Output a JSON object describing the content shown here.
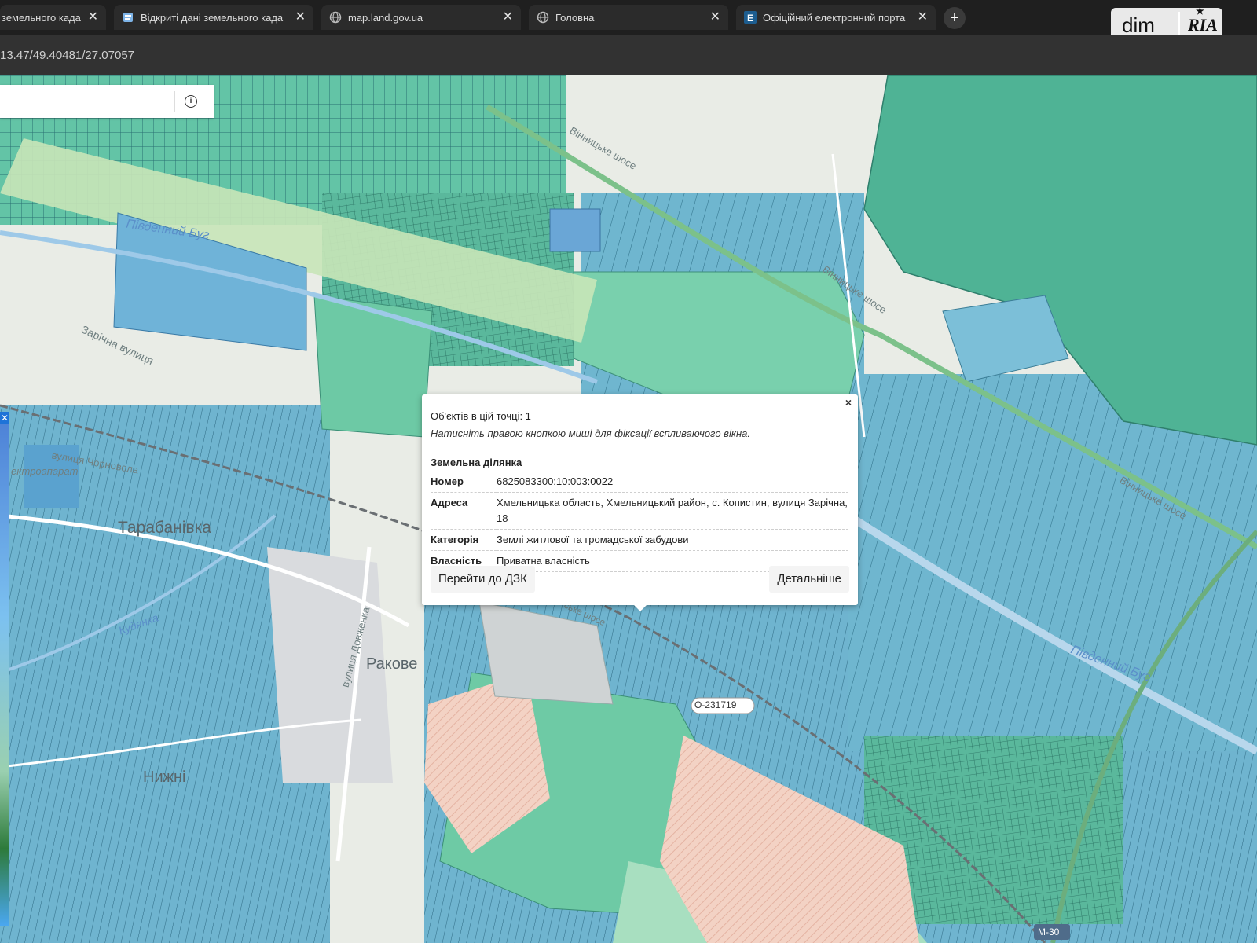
{
  "tabs": [
    {
      "label": "земельного када",
      "icon": "document-icon",
      "active": true
    },
    {
      "label": "Відкриті дані земельного када",
      "icon": "map-page-icon"
    },
    {
      "label": "map.land.gov.ua",
      "icon": "globe-icon"
    },
    {
      "label": "Головна",
      "icon": "globe-icon"
    },
    {
      "label": "Офіційний електронний порта",
      "icon": "e-logo-icon"
    }
  ],
  "new_tab": "+",
  "close_glyph": "✕",
  "brand": {
    "left": "dim",
    "right": "RIA"
  },
  "address": {
    "url": "13.47/49.40481/27.07057"
  },
  "search": {
    "value": "",
    "info": "i"
  },
  "side_panel": {
    "close": "✕"
  },
  "map_labels": {
    "southern_bug_1": "Південний Буг",
    "southern_bug_2": "Південний Буг",
    "vinnytske_1": "Вінницьке шосе",
    "vinnytske_2": "Вінницьке шосе",
    "vinnytske_3": "Вінницьке шосе",
    "zarichna": "Зарічна вулиця",
    "chornovola": "вулиця Чорновола",
    "elektro": "ектроапарат",
    "tarabanivka": "Тарабанівка",
    "kudyanka": "Кудянка",
    "dovzhenka": "вулиця Довженка",
    "rakove": "Ракове",
    "nyzhni": "Нижні",
    "road_o": "О-231719",
    "road_m30": "М-30",
    "shose": "ське шосе"
  },
  "popup": {
    "close": "×",
    "count": "Об'єктів в цій точці: 1",
    "hint": "Натисніть правою кнопкою миші для фіксації вспливаючого вікна.",
    "title": "Земельна ділянка",
    "rows": [
      {
        "key": "Номер",
        "value": "6825083300:10:003:0022"
      },
      {
        "key": "Адреса",
        "value": "Хмельницька область, Хмельницький район, с. Копистин, вулиця Зарічна, 18"
      },
      {
        "key": "Категорія",
        "value": "Землі житлової та громадської забудови"
      },
      {
        "key": "Власність",
        "value": "Приватна власність"
      }
    ],
    "btn_dzk": "Перейти до ДЗК",
    "btn_more": "Детальніше"
  }
}
